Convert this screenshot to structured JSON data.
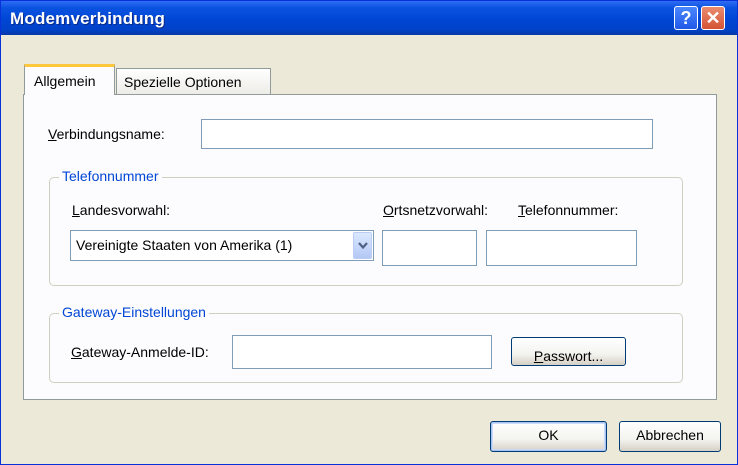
{
  "window": {
    "title": "Modemverbindung"
  },
  "titlebar": {
    "help_label": "?",
    "close_label": "✕"
  },
  "tabs": [
    {
      "label": "Allgemein",
      "active": true
    },
    {
      "label": "Spezielle Optionen",
      "active": false
    }
  ],
  "connection": {
    "label_access": "V",
    "label_rest": "erbindungsname:",
    "value": ""
  },
  "phone_group": {
    "legend": "Telefonnummer",
    "country_label_access": "L",
    "country_label_rest": "andesvorwahl:",
    "country_value": "Vereinigte Staaten von Amerika (1)",
    "area_label_access": "O",
    "area_label_rest": "rtsnetzvorwahl:",
    "area_value": "",
    "number_label_access": "T",
    "number_label_rest": "elefonnummer:",
    "number_value": ""
  },
  "gateway_group": {
    "legend": "Gateway-Einstellungen",
    "login_label_access": "G",
    "login_label_rest": "ateway-Anmelde-ID:",
    "login_value": "",
    "password_button_access": "P",
    "password_button_rest": "asswort..."
  },
  "footer": {
    "ok_label": "OK",
    "cancel_label": "Abbrechen"
  },
  "icons": {
    "dropdown": "chevron-down-icon",
    "help": "help-icon",
    "close": "close-icon"
  },
  "colors": {
    "titlebar": "#0046d5",
    "group_legend": "#0046d5",
    "tab_highlight": "#ffc83c",
    "dialog_bg": "#ece9d8"
  }
}
